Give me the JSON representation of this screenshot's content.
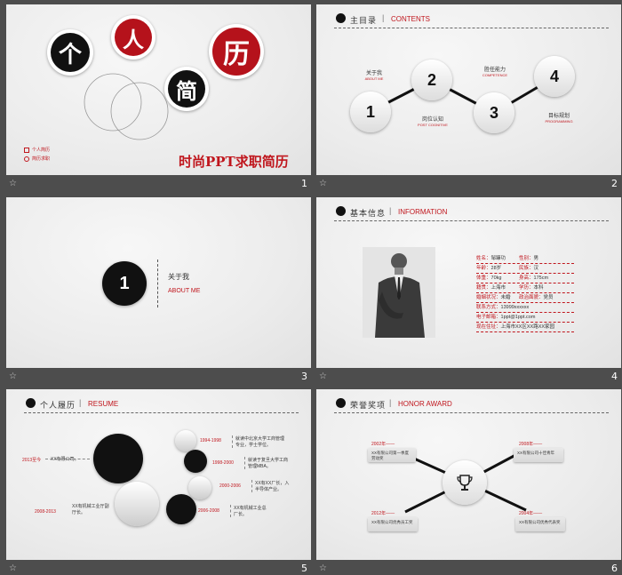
{
  "slides": [
    {
      "title_chars": [
        "个",
        "人",
        "简",
        "历"
      ],
      "subtitle": "时尚PPT求职简历",
      "meta": [
        "个人简历",
        "简历求职"
      ],
      "page": "1"
    },
    {
      "header_cn": "主目录",
      "header_en": "CONTENTS",
      "items": [
        {
          "num": "1",
          "cn": "关于我",
          "en": "ABOUT ME"
        },
        {
          "num": "2",
          "cn": "岗位认知",
          "en": "POST COGNITIVE"
        },
        {
          "num": "3",
          "cn": "胜任能力",
          "en": "COMPETENCE"
        },
        {
          "num": "4",
          "cn": "目标规划",
          "en": "PROGRAMMING"
        }
      ],
      "page": "2"
    },
    {
      "num": "1",
      "cn": "关于我",
      "en": "ABOUT ME",
      "page": "3"
    },
    {
      "header_cn": "基本信息",
      "header_en": "INFORMATION",
      "fields": [
        {
          "label": "姓名：",
          "value": "邹臻功",
          "label2": "性别：",
          "value2": "男"
        },
        {
          "label": "年龄：",
          "value": "28岁",
          "label2": "民族：",
          "value2": "汉"
        },
        {
          "label": "体重：",
          "value": "70kg",
          "label2": "身高：",
          "value2": "175cm"
        },
        {
          "label": "籍贯：",
          "value": "上海市",
          "label2": "学历：",
          "value2": "本科"
        },
        {
          "label": "婚姻状况：",
          "value": "未婚",
          "label2": "政治面貌：",
          "value2": "党员"
        },
        {
          "label": "联系方式：",
          "value": "13999xxxxxx",
          "label2": "",
          "value2": ""
        },
        {
          "label": "电子邮箱：",
          "value": "1ppt@1ppt.com",
          "label2": "",
          "value2": ""
        },
        {
          "label": "现在住址：",
          "value": "上海市XX区XX路XX家园",
          "label2": "",
          "value2": ""
        }
      ],
      "page": "4"
    },
    {
      "header_cn": "个人履历",
      "header_en": "RESUME",
      "entries": [
        {
          "year": "2013至今",
          "text": "XX有限公司。"
        },
        {
          "year": "2008-2013",
          "text": "XX有机械工业厅副厅长。"
        },
        {
          "year": "1994-1998",
          "text": "就读中北京大学工商管理专业，学士学位。"
        },
        {
          "year": "1998-2000",
          "text": "就读于复旦大学工商管理MBA。"
        },
        {
          "year": "2000-2006",
          "text": "XX有XX厂长，入半导体产业。"
        },
        {
          "year": "2006-2008",
          "text": "XX有机械工业总厂长。"
        }
      ],
      "page": "5"
    },
    {
      "header_cn": "荣誉奖项",
      "header_en": "HONOR AWARD",
      "awards": [
        {
          "year": "2002年——",
          "text": "XX有限公司第一季度劳动奖"
        },
        {
          "year": "2008年——",
          "text": "XX有限公司十佳青年"
        },
        {
          "year": "2012年——",
          "text": "XX有限公司优秀员工奖"
        },
        {
          "year": "2004年——",
          "text": "XX有限公司优秀代表奖"
        }
      ],
      "page": "6"
    }
  ],
  "footer_icon": "slide-transition-icon",
  "colors": {
    "accent": "#c0161d",
    "dark": "#111111",
    "bg": "#4d4d4d"
  }
}
